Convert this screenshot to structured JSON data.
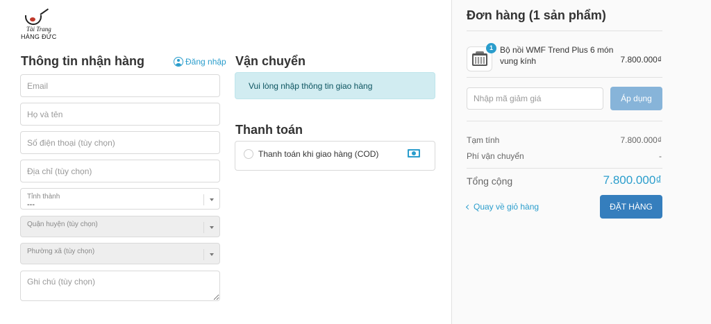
{
  "brand": {
    "top": "Tài Trang",
    "bottom": "HÀNG ĐỨC"
  },
  "customer": {
    "title": "Thông tin nhận hàng",
    "login_label": "Đăng nhập",
    "email_placeholder": "Email",
    "name_placeholder": "Họ và tên",
    "phone_placeholder": "Số điện thoại (tùy chọn)",
    "address_placeholder": "Địa chỉ (tùy chọn)",
    "province_label": "Tỉnh thành",
    "province_value": "---",
    "district_label": "Quận huyện (tùy chọn)",
    "ward_label": "Phường xã (tùy chọn)",
    "note_placeholder": "Ghi chú (tùy chọn)"
  },
  "shipping": {
    "title": "Vận chuyển",
    "message": "Vui lòng nhập thông tin giao hàng"
  },
  "payment": {
    "title": "Thanh toán",
    "method_label": "Thanh toán khi giao hàng (COD)",
    "method_icon": "cash-icon"
  },
  "order": {
    "title": "Đơn hàng (1 sản phẩm)",
    "item": {
      "quantity": "1",
      "name": "Bộ nồi WMF Trend Plus 6 món vung kính",
      "price": "7.800.000₫"
    },
    "discount_placeholder": "Nhập mã giảm giá",
    "apply_label": "Áp dụng",
    "subtotal_label": "Tạm tính",
    "subtotal_value": "7.800.000₫",
    "shipping_fee_label": "Phí vận chuyển",
    "shipping_fee_value": "-",
    "total_label": "Tổng cộng",
    "total_value": "7.800.000₫",
    "back_label": "Quay về giỏ hàng",
    "place_order_label": "ĐẶT HÀNG"
  },
  "colors": {
    "accent": "#2a9dcc",
    "primary_button": "#357ebd",
    "apply_button": "#87b4d9",
    "info_box": "#d1ecf1"
  }
}
